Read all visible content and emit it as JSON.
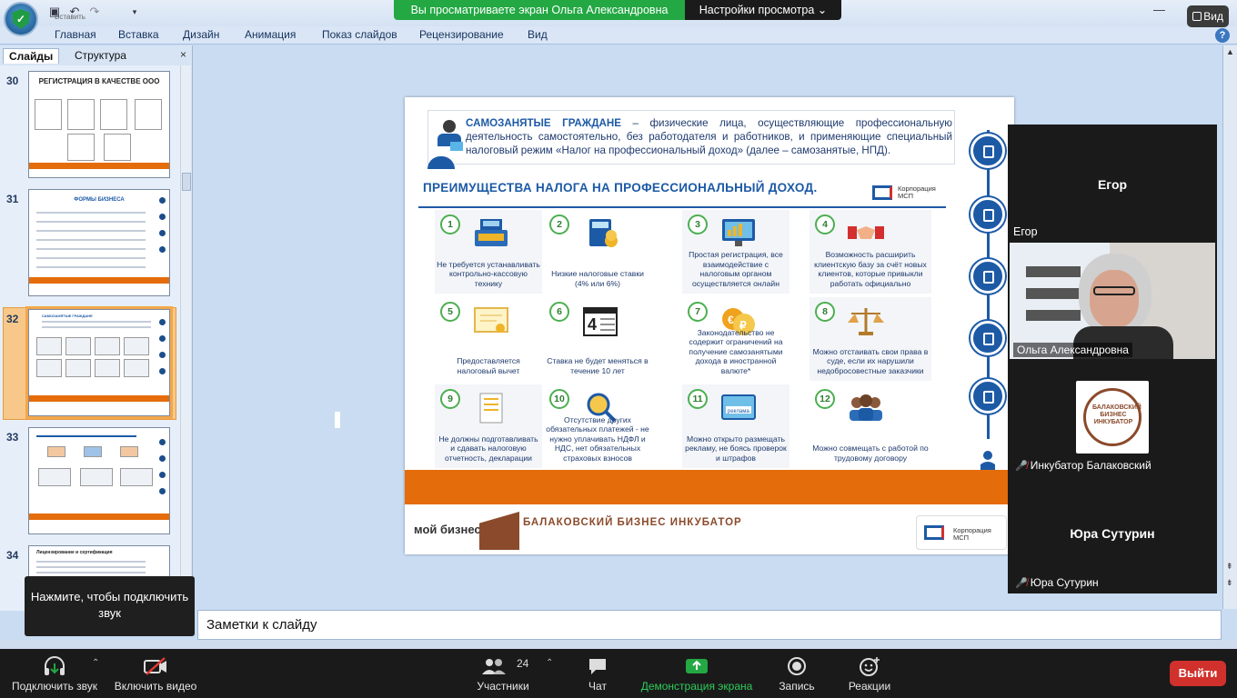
{
  "zoom_banner": {
    "viewing": "Вы просматриваете экран Ольга Александровна",
    "view_options": "Настройки просмотра",
    "view_button": "Вид"
  },
  "ppt": {
    "qat_label": "Вставить",
    "ribbon_tabs": [
      "Главная",
      "Вставка",
      "Дизайн",
      "Анимация",
      "Показ слайдов",
      "Рецензирование",
      "Вид"
    ],
    "panel_tabs": {
      "slides": "Слайды",
      "outline": "Структура"
    },
    "slide_numbers": [
      "30",
      "31",
      "32",
      "33",
      "34"
    ],
    "thumb_titles": [
      "РЕГИСТРАЦИЯ В КАЧЕСТВЕ ООО",
      "ФОРМЫ БИЗНЕСА",
      "САМОЗАНЯТЫЕ ГРАЖДАНЕ",
      "",
      "Лицензирование и сертификация"
    ],
    "notes_placeholder": "Заметки к слайду"
  },
  "slide": {
    "head_bold": "САМОЗАНЯТЫЕ ГРАЖДАНЕ",
    "head_text": " – физические лица, осуществляющие профессиональную деятельность самостоятельно, без работодателя и работников, и применяющие специальный налоговый режим «Налог на профессиональный доход» (далее – самозанятые, НПД).",
    "title": "ПРЕИМУЩЕСТВА НАЛОГА НА ПРОФЕССИОНАЛЬНЫЙ ДОХОД.",
    "corp": "Корпорация МСП",
    "items": [
      {
        "n": "1",
        "text": "Не требуется устанавливать контрольно-кассовую технику"
      },
      {
        "n": "2",
        "text": "Низкие налоговые ставки (4% или 6%)"
      },
      {
        "n": "3",
        "text": "Простая регистрация, все взаимодействие с налоговым органом осуществляется онлайн"
      },
      {
        "n": "4",
        "text": "Возможность расширить клиентскую базу за счёт новых клиентов, которые привыкли работать официально"
      },
      {
        "n": "5",
        "text": "Предоставляется налоговый вычет"
      },
      {
        "n": "6",
        "text": "Ставка не будет меняться в течение 10 лет"
      },
      {
        "n": "7",
        "text": "Законодательство не содержит ограничений на получение самозанятыми дохода в иностранной валюте*"
      },
      {
        "n": "8",
        "text": "Можно отстаивать свои права в суде, если их нарушили недобросовестные заказчики"
      },
      {
        "n": "9",
        "text": "Не должны подготавливать и сдавать налоговую отчетность, декларации"
      },
      {
        "n": "10",
        "text": "Отсутствие других обязательных платежей - не нужно уплачивать НДФЛ и НДС, нет обязательных страховых взносов"
      },
      {
        "n": "11",
        "text": "Можно открыто размещать рекламу, не боясь проверок и штрафов"
      },
      {
        "n": "12",
        "text": "Можно совмещать с работой по трудовому договору"
      }
    ],
    "footer_moi": "мой бизнес",
    "footer_bbi": "БАЛАКОВСКИЙ БИЗНЕС ИНКУБАТОР",
    "footer_corp": "Корпорация МСП",
    "reklama": "реклама"
  },
  "participants": {
    "egor_big": "Егор",
    "egor_label": "Егор",
    "olga": "Ольга Александровна",
    "incubator": "Инкубатор Балаковский",
    "incubator_logo": "БАЛАКОВСКИЙ БИЗНЕС ИНКУБАТОР",
    "yura_big": "Юра Сутурин",
    "yura": "Юра Сутурин"
  },
  "tooltip": "Нажмите, чтобы подключить звук",
  "toolbar": {
    "audio": "Подключить звук",
    "video": "Включить видео",
    "participants": "Участники",
    "participants_count": "24",
    "chat": "Чат",
    "share": "Демонстрация экрана",
    "record": "Запись",
    "reactions": "Реакции",
    "leave": "Выйти"
  },
  "colors": {
    "accent_blue": "#1d5aa6",
    "orange": "#e46c0a",
    "zoom_green": "#23a843",
    "leave_red": "#d0312d"
  }
}
